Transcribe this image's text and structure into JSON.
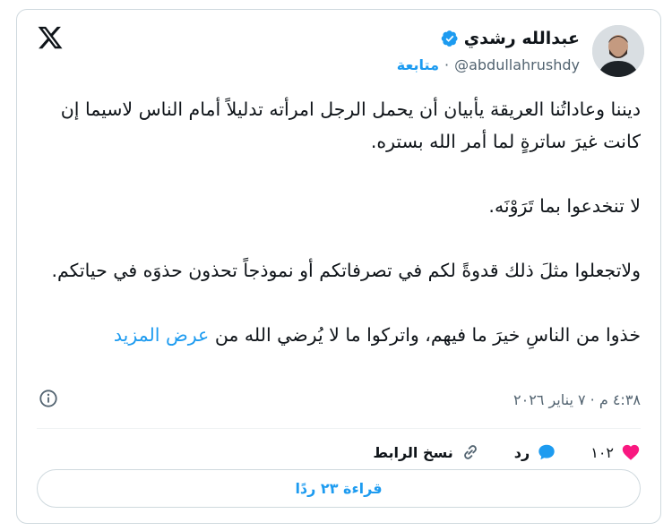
{
  "author": {
    "name": "عبدالله رشدي",
    "handle": "@abdullahrushdy",
    "follow_label": "متابعة",
    "separator": "·"
  },
  "tweet": {
    "paragraphs": [
      "ديننا وعاداتُنا العريقة يأبيان أن يحمل الرجل امرأته تدليلاً أمام الناس لاسيما إن كانت غيرَ ساترةٍ لما أمر الله بستره.",
      "لا تنخدعوا بما تَرَوْنَه.",
      "ولاتجعلوا مثلَ ذلك قدوةً لكم في تصرفاتكم أو نموذجاً تحذون حذوَه في حياتكم.",
      "خذوا من الناسِ خيرَ ما فيهم، واتركوا ما لا يُرضي الله من"
    ],
    "show_more": "عرض المزيد",
    "timestamp": "٤:٣٨ م · ٧ يناير ٢٠٢٦"
  },
  "actions": {
    "likes_count": "١٠٢",
    "reply_label": "رد",
    "copy_link_label": "نسخ الرابط"
  },
  "read_replies_label": "قراءة ٢٣ ردًا",
  "colors": {
    "accent": "#1d9bf0",
    "like": "#f91880",
    "text": "#0f1419",
    "muted": "#536471"
  },
  "icons": [
    "x-logo-icon",
    "verified-badge-icon",
    "info-icon",
    "heart-icon",
    "reply-bubble-icon",
    "link-icon"
  ]
}
